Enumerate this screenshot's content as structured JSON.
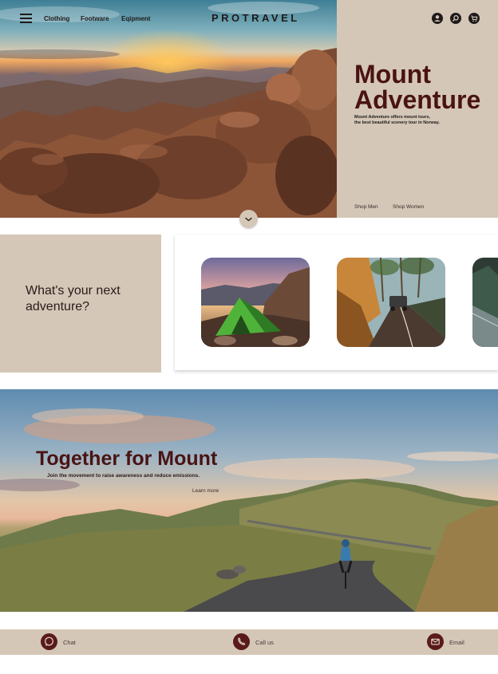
{
  "nav": {
    "brand": "PROTRAVEL",
    "links": [
      "Clothing",
      "Footware",
      "Eqipment"
    ],
    "icons": [
      "menu-icon",
      "account-icon",
      "search-icon",
      "cart-icon"
    ]
  },
  "hero": {
    "title_line1": "Mount",
    "title_line2": "Adventure",
    "description_line1": "Mount Adventure offers mount tours,",
    "description_line2": "the best beautiful scenery tour in Norway.",
    "cta_men": "Shop Men",
    "cta_women": "Shop Women"
  },
  "adventure": {
    "question_line1": "What's your next",
    "question_line2": "adventure?",
    "cards": [
      "tent-camping",
      "road-trip",
      "mountain-trail"
    ]
  },
  "banner": {
    "title": "Together for Mount",
    "subtitle": "Join the movement to raise awareness and reduce emissions.",
    "link": "Learn more"
  },
  "contact": {
    "chat": "Chat",
    "call": "Call us",
    "email": "Email"
  },
  "colors": {
    "beige": "#d4c7b7",
    "brown": "#4a1313",
    "icon_dark": "#1f1a1a",
    "contact_icon": "#5a1a1a"
  }
}
